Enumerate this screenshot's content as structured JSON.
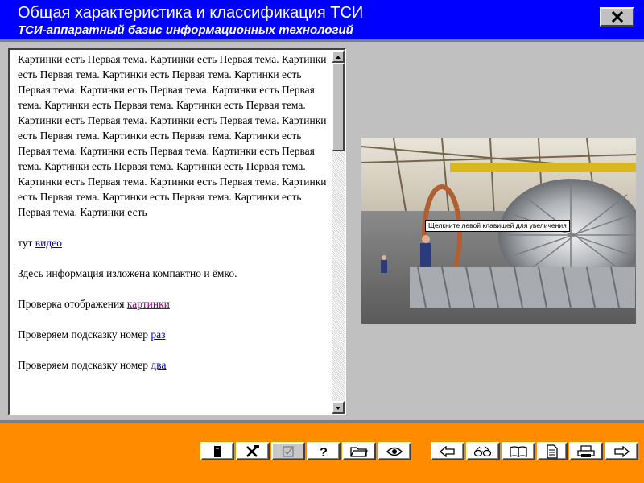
{
  "header": {
    "title": "Общая характеристика и классификация ТСИ",
    "subtitle": "ТСИ-аппаратный базис информационных технологий"
  },
  "content": {
    "intro_text": "Картинки есть Первая тема. Картинки есть Первая тема. Картинки есть Первая тема. Картинки есть Первая тема. Картинки есть Первая тема. Картинки есть Первая тема. Картинки есть Первая тема. Картинки есть Первая тема. Картинки есть Первая тема. Картинки есть Первая тема. Картинки есть Первая тема. Картинки есть Первая тема. Картинки есть Первая тема. Картинки есть Первая тема. Картинки есть Первая тема. Картинки есть Первая тема. Картинки есть Первая тема. Картинки есть Первая тема. Картинки есть Первая тема. Картинки есть Первая тема. Картинки есть Первая тема. Картинки есть Первая тема. Картинки есть Первая тема. Картинки есть",
    "video_prefix": "тут ",
    "video_link": "видео",
    "info_line": "Здесь информация изложена компактно и ёмко.",
    "picture_prefix": "Проверка отображения ",
    "picture_link": "картинки",
    "hint1_prefix": "Проверяем подсказку номер ",
    "hint1_link": "раз",
    "hint2_prefix": "Проверяем подсказку номер ",
    "hint2_link": "два"
  },
  "image": {
    "tooltip": "Щелкните левой клавишей для увеличения"
  },
  "colors": {
    "title_bar": "#0000ff",
    "bottom_panel": "#ff8c00",
    "link": "#0000cc",
    "visited_link": "#800080"
  },
  "toolbar": {
    "left_group": [
      "contents-icon",
      "tools-icon",
      "checkbox-icon",
      "help-icon",
      "folder-icon",
      "eye-icon"
    ],
    "right_group": [
      "arrow-left-icon",
      "glasses-icon",
      "book-icon",
      "document-icon",
      "printer-icon",
      "arrow-right-icon"
    ],
    "disabled": [
      "checkbox-icon"
    ]
  }
}
